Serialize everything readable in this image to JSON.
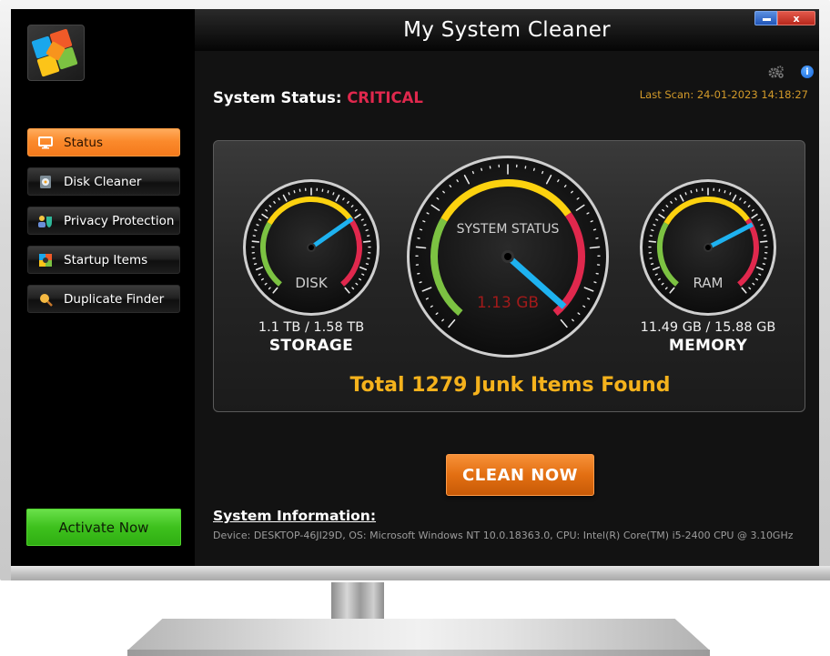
{
  "app": {
    "title": "My System Cleaner",
    "minimize_label": "",
    "close_label": "x"
  },
  "sidebar": {
    "items": [
      {
        "label": "Status",
        "icon": "monitor-icon",
        "glyph": "🖥",
        "active": true
      },
      {
        "label": "Disk Cleaner",
        "icon": "disk-cleaner-icon",
        "glyph": "💿",
        "active": false
      },
      {
        "label": "Privacy Protection",
        "icon": "privacy-shield-icon",
        "glyph": "🛡",
        "active": false
      },
      {
        "label": "Startup Items",
        "icon": "startup-icon",
        "glyph": "🚀",
        "active": false
      },
      {
        "label": "Duplicate Finder",
        "icon": "duplicate-finder-icon",
        "glyph": "🔍",
        "active": false
      }
    ],
    "activate_label": "Activate Now"
  },
  "header": {
    "status_label": "System Status:",
    "status_value": "CRITICAL",
    "last_scan": "Last Scan: 24-01-2023 14:18:27",
    "settings_icon": "gear-icon",
    "info_icon": "info-icon",
    "info_glyph": "i"
  },
  "gauges": {
    "disk": {
      "dial_label": "DISK",
      "value_text": "1.1 TB / 1.58 TB",
      "caption": "STORAGE",
      "used": 1.1,
      "total": 1.58
    },
    "system": {
      "dial_label": "SYSTEM STATUS",
      "reading": "1.13 GB",
      "level": 0.97
    },
    "ram": {
      "dial_label": "RAM",
      "value_text": "11.49 GB / 15.88 GB",
      "caption": "MEMORY",
      "used": 11.49,
      "total": 15.88
    }
  },
  "junk_summary": "Total 1279 Junk Items Found",
  "clean_now_label": "CLEAN NOW",
  "system_info": {
    "title": "System Information:",
    "text": "Device: DESKTOP-46JI29D, OS: Microsoft Windows NT 10.0.18363.0, CPU: Intel(R) Core(TM) i5-2400 CPU @ 3.10GHz"
  },
  "colors": {
    "critical": "#e0284d",
    "accent_orange": "#f47a1c",
    "activate_green": "#3ec11d",
    "junk_yellow": "#f5b21c",
    "needle": "#1eb2f0",
    "arc_green": "#7cc242",
    "arc_yellow": "#fcd20f",
    "arc_red": "#e0284d"
  }
}
